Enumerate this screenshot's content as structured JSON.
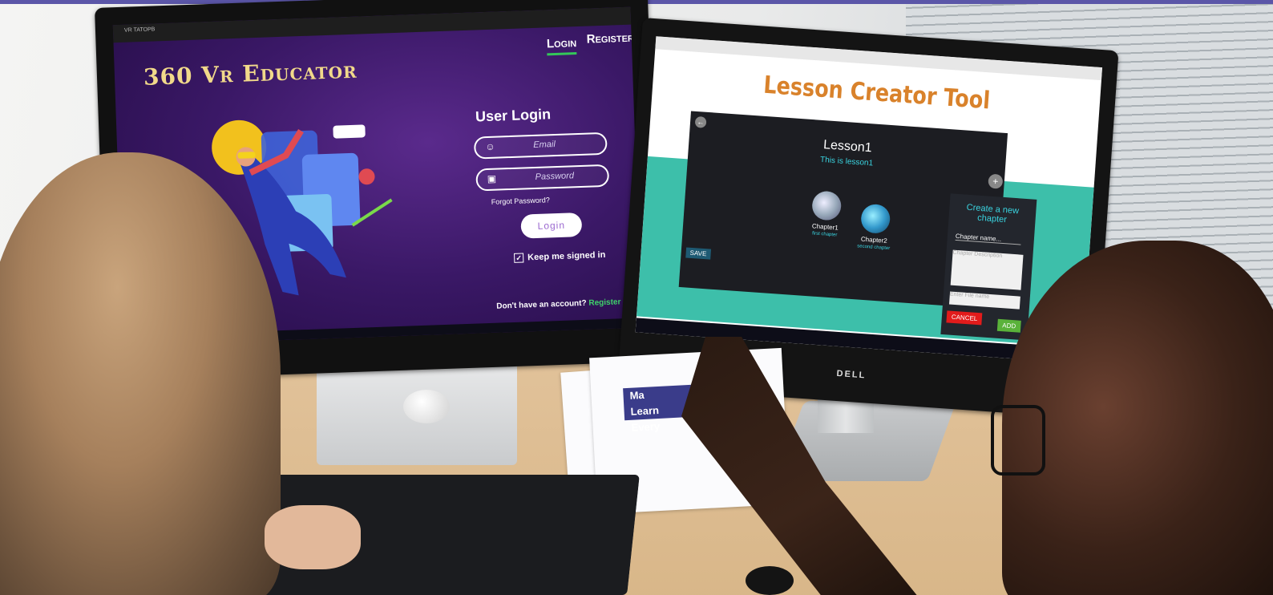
{
  "left_screen": {
    "window_title": "VR TATOPB",
    "app_title": "360 Vr Educator",
    "nav": {
      "login": "Login",
      "register": "Register"
    },
    "login_heading": "User Login",
    "email_placeholder": "Email",
    "password_placeholder": "Password",
    "forgot_password": "Forgot Password?",
    "login_button": "Login",
    "keep_signed_in": "Keep me signed in",
    "no_account_text": "Don't have an account?",
    "register_link": "Register"
  },
  "right_screen": {
    "page_title": "Lesson Creator Tool",
    "lesson_name": "Lesson1",
    "lesson_description": "This is lesson1",
    "chapters": [
      {
        "name": "Chapter1",
        "description": "first chapter"
      },
      {
        "name": "Chapter2",
        "description": "second chapter"
      }
    ],
    "save_button": "SAVE",
    "new_chapter_panel": {
      "title": "Create a new chapter",
      "chapter_name_placeholder": "Chapter name...",
      "chapter_description_placeholder": "Chapter Description",
      "file_name_placeholder": "Enter File name",
      "cancel_button": "CANCEL",
      "add_button": "ADD"
    },
    "monitor_brand": "DELL"
  },
  "booklet": {
    "banner_text": "Ma\nLearn\nEvery"
  },
  "colors": {
    "top_bar": "#5b56a8",
    "login_bg": "#3a1866",
    "title_gold": "#f1d98a",
    "accent_green": "#3fd36a",
    "lct_orange": "#d9822b",
    "teal": "#3dbfaa",
    "cancel_red": "#e21b1b",
    "add_green": "#5ab23a"
  }
}
